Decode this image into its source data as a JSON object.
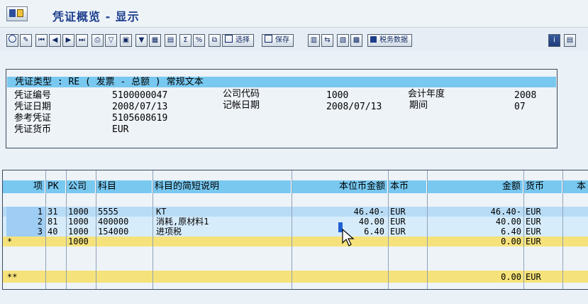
{
  "window": {
    "title": "凭证概览 - 显示"
  },
  "toolbar": {
    "select_label": "选择",
    "save_label": "保存",
    "tax_data_label": "税务数据"
  },
  "header": {
    "doc_type_line": "凭证类型  : RE ( 发票 - 总额 ) 常规文本",
    "doc_no_label": "凭证编号",
    "doc_no": "5100000047",
    "company_code_label": "公司代码",
    "company_code": "1000",
    "fiscal_year_label": "会计年度",
    "fiscal_year": "2008",
    "doc_date_label": "凭证日期",
    "doc_date": "2008/07/13",
    "posting_date_label": "记帐日期",
    "posting_date": "2008/07/13",
    "period_label": "期间",
    "period": "07",
    "ref_doc_label": "参考凭证",
    "ref_doc": "5105608619",
    "currency_label": "凭证货币",
    "currency": "EUR"
  },
  "grid": {
    "columns": [
      "项",
      "PK",
      "公司",
      "科目",
      "科目的简短说明",
      "本位币金额",
      "本币",
      "金额",
      "货币",
      "本"
    ],
    "rows": [
      {
        "item": "1",
        "pk": "31",
        "company": "1000",
        "account": "5555",
        "desc": "KT",
        "lc_amount": "46.40-",
        "lc_curr": "EUR",
        "amount": "46.40-",
        "curr": "EUR"
      },
      {
        "item": "2",
        "pk": "81",
        "company": "1000",
        "account": "400000",
        "desc": "消耗,原材料1",
        "lc_amount": "40.00",
        "lc_curr": "EUR",
        "amount": "40.00",
        "curr": "EUR"
      },
      {
        "item": "3",
        "pk": "40",
        "company": "1000",
        "account": "154000",
        "desc": "进项税",
        "lc_amount": "6.40",
        "lc_curr": "EUR",
        "amount": "6.40",
        "curr": "EUR"
      }
    ],
    "entry_row": {
      "marker": "*",
      "company": "1000",
      "amount": "0.00",
      "curr": "EUR"
    },
    "total_row": {
      "marker": "**",
      "amount": "0.00",
      "curr": "EUR"
    }
  },
  "colors": {
    "header_blue": "#78c8f0",
    "yellow": "#f6e27a",
    "row_light": "#d7ecfb",
    "row_selected": "#b9dcf6"
  }
}
